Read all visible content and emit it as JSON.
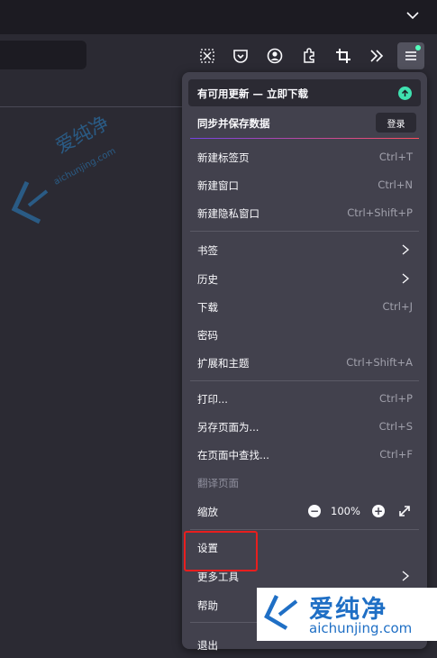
{
  "toolbar": {
    "icons": [
      "screenshot-icon",
      "pocket-icon",
      "account-icon",
      "extensions-icon",
      "crop-icon",
      "overflow-icon",
      "menu-icon"
    ]
  },
  "menu": {
    "update_banner": "有可用更新 — 立即下载",
    "sync_label": "同步并保存数据",
    "login_button": "登录",
    "items": [
      {
        "label": "新建标签页",
        "shortcut": "Ctrl+T"
      },
      {
        "label": "新建窗口",
        "shortcut": "Ctrl+N"
      },
      {
        "label": "新建隐私窗口",
        "shortcut": "Ctrl+Shift+P"
      },
      {
        "label": "书签",
        "shortcut": ""
      },
      {
        "label": "历史",
        "shortcut": ""
      },
      {
        "label": "下载",
        "shortcut": "Ctrl+J"
      },
      {
        "label": "密码",
        "shortcut": ""
      },
      {
        "label": "扩展和主题",
        "shortcut": "Ctrl+Shift+A"
      },
      {
        "label": "打印...",
        "shortcut": "Ctrl+P"
      },
      {
        "label": "另存页面为...",
        "shortcut": "Ctrl+S"
      },
      {
        "label": "在页面中查找...",
        "shortcut": "Ctrl+F"
      },
      {
        "label": "翻译页面",
        "shortcut": ""
      },
      {
        "label": "缩放",
        "shortcut": ""
      },
      {
        "label": "设置",
        "shortcut": ""
      },
      {
        "label": "更多工具",
        "shortcut": ""
      },
      {
        "label": "帮助",
        "shortcut": ""
      },
      {
        "label": "退出",
        "shortcut": ""
      }
    ],
    "zoom": {
      "minus": "−",
      "value": "100%",
      "plus": "+"
    }
  },
  "watermark": {
    "chinese": "爱纯净",
    "domain": "aichunjing.com"
  },
  "colors": {
    "panel_bg": "#42414d",
    "toolbar_bg": "#2b2a33",
    "tabstrip_bg": "#1c1b22",
    "update_icon": "#3fe1b0",
    "highlight": "#e81e1e",
    "watermark_blue": "#1f6fc5"
  }
}
